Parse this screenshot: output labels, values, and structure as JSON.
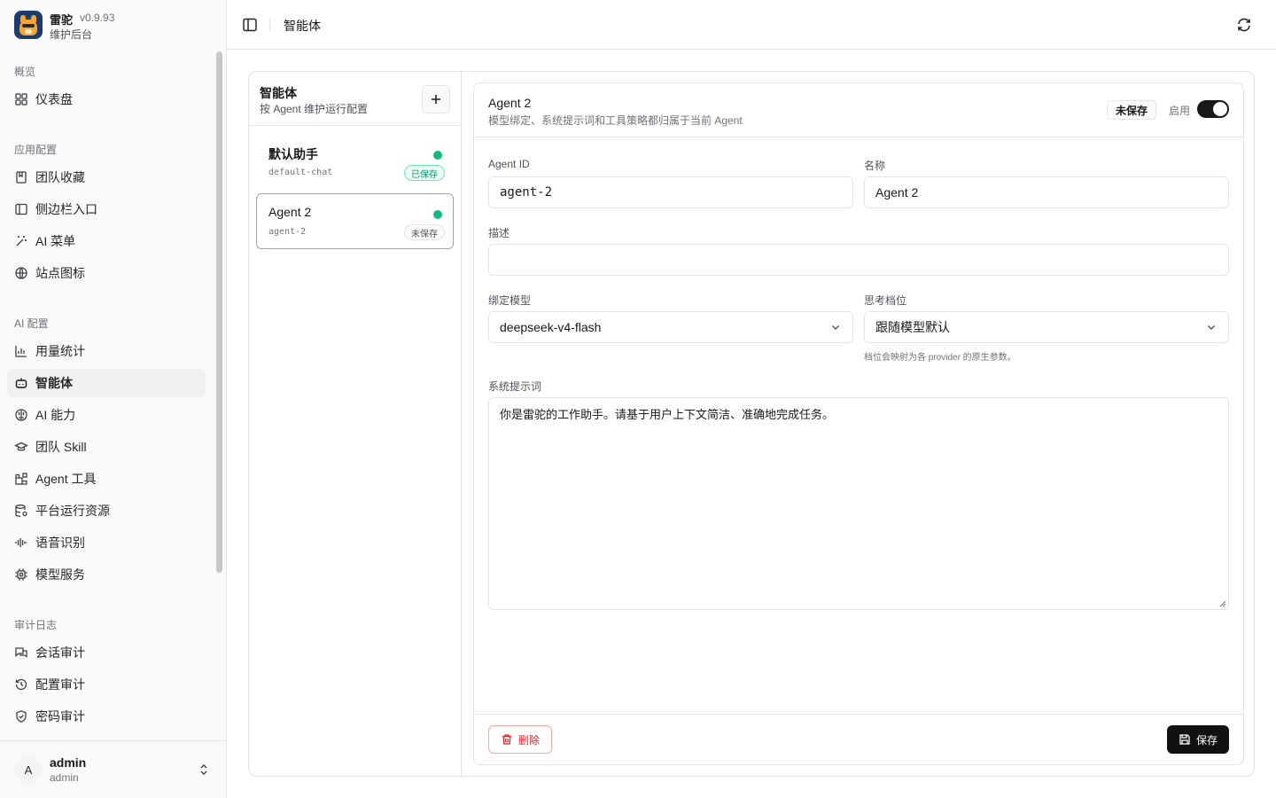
{
  "brand": {
    "name": "雷驼",
    "version": "v0.9.93",
    "subtitle": "维护后台"
  },
  "sidebar": {
    "groups": [
      {
        "label": "概览",
        "items": [
          {
            "label": "仪表盘",
            "icon": "dashboard-icon"
          }
        ]
      },
      {
        "label": "应用配置",
        "items": [
          {
            "label": "团队收藏",
            "icon": "bookmark-icon"
          },
          {
            "label": "侧边栏入口",
            "icon": "sidebar-icon"
          },
          {
            "label": "AI 菜单",
            "icon": "sparkle-wand-icon"
          },
          {
            "label": "站点图标",
            "icon": "globe-icon"
          }
        ]
      },
      {
        "label": "AI 配置",
        "items": [
          {
            "label": "用量统计",
            "icon": "bar-chart-icon"
          },
          {
            "label": "智能体",
            "icon": "bot-icon",
            "active": true
          },
          {
            "label": "AI 能力",
            "icon": "brain-icon"
          },
          {
            "label": "团队 Skill",
            "icon": "graduation-cap-icon"
          },
          {
            "label": "Agent 工具",
            "icon": "blocks-icon"
          },
          {
            "label": "平台运行资源",
            "icon": "database-settings-icon"
          },
          {
            "label": "语音识别",
            "icon": "audio-waveform-icon"
          },
          {
            "label": "模型服务",
            "icon": "cpu-icon"
          }
        ]
      },
      {
        "label": "审计日志",
        "items": [
          {
            "label": "会话审计",
            "icon": "messages-icon"
          },
          {
            "label": "配置审计",
            "icon": "history-icon"
          },
          {
            "label": "密码审计",
            "icon": "shield-check-icon"
          }
        ]
      }
    ]
  },
  "user": {
    "initial": "A",
    "name": "admin",
    "role": "admin"
  },
  "header": {
    "title": "智能体"
  },
  "list": {
    "title": "智能体",
    "subtitle": "按 Agent 维护运行配置",
    "add_symbol": "+",
    "agents": [
      {
        "name": "默认助手",
        "id": "default-chat",
        "status": "已保存"
      },
      {
        "name": "Agent 2",
        "id": "agent-2",
        "status": "未保存"
      }
    ]
  },
  "detail": {
    "title": "Agent 2",
    "subtitle": "模型绑定、系统提示词和工具策略都归属于当前 Agent",
    "status_badge": "未保存",
    "enable_label": "启用",
    "enabled": true,
    "fields": {
      "agent_id": {
        "label": "Agent ID",
        "value": "agent-2"
      },
      "name": {
        "label": "名称",
        "value": "Agent 2"
      },
      "description": {
        "label": "描述",
        "value": ""
      },
      "model": {
        "label": "绑定模型",
        "value": "deepseek-v4-flash"
      },
      "thinking": {
        "label": "思考档位",
        "value": "跟随模型默认",
        "hint": "档位会映射为各 provider 的原生参数。"
      },
      "system_prompt": {
        "label": "系统提示词",
        "value": "你是雷驼的工作助手。请基于用户上下文简洁、准确地完成任务。"
      }
    },
    "delete_label": "删除",
    "save_label": "保存"
  },
  "colors": {
    "accent": "#18181b",
    "success": "#10b981",
    "danger": "#dc2626"
  }
}
